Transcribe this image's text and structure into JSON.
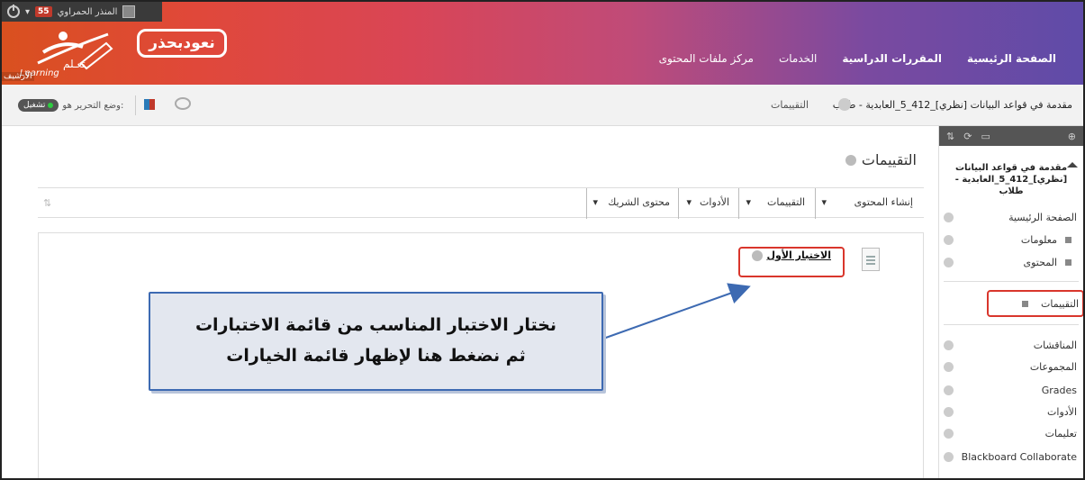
{
  "user_strip": {
    "name": "المنذر الحمراوي",
    "notification_count": "55"
  },
  "logo": {
    "brand": "نعودبحذر",
    "learn_ar": "تعـلم",
    "learn_en": "Learning",
    "side_tag": "الأرشيف"
  },
  "nav": {
    "items": [
      "الصفحة الرئيسية",
      "المقررات الدراسية",
      "الخدمات",
      "مركز ملفات المحتوى"
    ],
    "active_index": 1
  },
  "breadcrumb": {
    "course": "مقدمة في قواعد البيانات [نظري]_412_5_العابدية - طلاب",
    "page": "التقييمات"
  },
  "edit_mode": {
    "label": "وضع التحرير هو:",
    "state": "تشغيل"
  },
  "main": {
    "title": "التقييمات",
    "toolbar": [
      "إنشاء المحتوى",
      "التقييمات",
      "الأدوات",
      "محتوى الشريك"
    ],
    "test_item": "الاختبار الأول"
  },
  "sidebar": {
    "course_title": "مقدمة في قواعد البيانات [نظري]_412_5_العابدية - طلاب",
    "items": [
      "الصفحة الرئيسية",
      "معلومات",
      "المحتوى",
      "التقييمات",
      "المناقشات",
      "المجموعات",
      "Grades",
      "الأدوات",
      "تعليمات",
      "Blackboard Collaborate"
    ]
  },
  "callout": {
    "line1": "نختار الاختبار المناسب من قائمة الاختبارات",
    "line2": "ثم نضغط هنا لإظهار قائمة الخيارات"
  },
  "colors": {
    "highlight": "#d9362c",
    "callout_border": "#3d6ab2",
    "callout_bg": "#e3e7ef"
  }
}
